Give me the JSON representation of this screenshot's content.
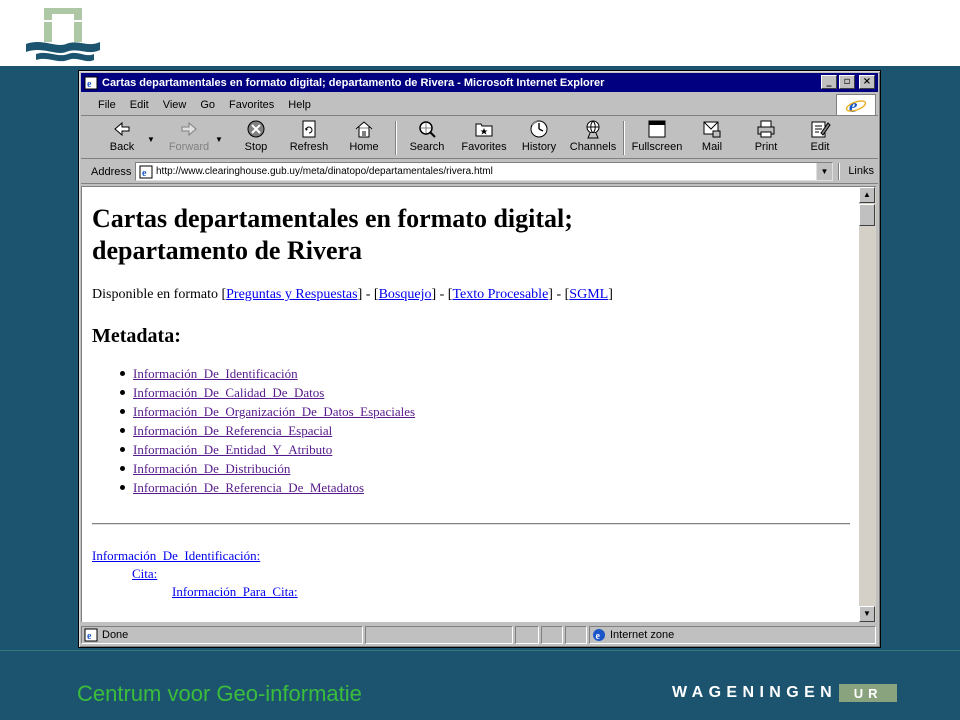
{
  "slide": {
    "footer_title": "Centrum voor Geo-informatie",
    "brand_text": "WAGENINGEN",
    "brand_suffix": "UR",
    "colors": {
      "background": "#1c5470",
      "footer_title": "#3bbd3b",
      "brand_box": "#8aa37f"
    }
  },
  "window": {
    "title": "Cartas departamentales en formato digital; departamento de Rivera - Microsoft Internet Explorer",
    "controls": [
      "minimize",
      "restore",
      "close"
    ]
  },
  "menu": [
    "File",
    "Edit",
    "View",
    "Go",
    "Favorites",
    "Help"
  ],
  "toolbar": {
    "back": "Back",
    "forward": "Forward",
    "stop": "Stop",
    "refresh": "Refresh",
    "home": "Home",
    "search": "Search",
    "favorites": "Favorites",
    "history": "History",
    "channels": "Channels",
    "fullscreen": "Fullscreen",
    "mail": "Mail",
    "print": "Print",
    "edit": "Edit"
  },
  "address": {
    "label": "Address",
    "url": "http://www.clearinghouse.gub.uy/meta/dinatopo/departamentales/rivera.html",
    "links_label": "Links"
  },
  "page": {
    "title_line1": "Cartas departamentales en formato digital;",
    "title_line2": "departamento de Rivera",
    "available_prefix": "Disponible en formato [",
    "formats": [
      "Preguntas y Respuestas",
      "Bosquejo",
      "Texto Procesable",
      "SGML"
    ],
    "separator": "] - [",
    "available_suffix": "]",
    "metadata_heading": "Metadata:",
    "toc": [
      "Información_De_Identificación",
      "Información_De_Calidad_De_Datos",
      "Información_De_Organización_De_Datos_Espaciales",
      "Información_De_Referencia_Espacial",
      "Información_De_Entidad_Y_Atributo",
      "Información_De_Distribución",
      "Información_De_Referencia_De_Metadatos"
    ],
    "detail_l0": "Información_De_Identificación:",
    "detail_l1": "Cita:",
    "detail_l2": "Información_Para_Cita:"
  },
  "status": {
    "text": "Done",
    "zone": "Internet zone"
  }
}
